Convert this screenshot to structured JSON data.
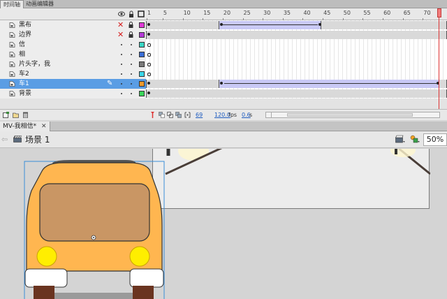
{
  "panel_tabs": [
    {
      "label": "时间轴",
      "active": true
    },
    {
      "label": "动画编辑器",
      "active": false
    }
  ],
  "timeline": {
    "header_icons": [
      "eye-icon",
      "lock-icon",
      "outline-icon"
    ],
    "ruler_labels": [
      "1",
      "5",
      "10",
      "15",
      "20",
      "25",
      "30",
      "35",
      "40",
      "45",
      "50",
      "55",
      "60",
      "65",
      "70"
    ],
    "layers": [
      {
        "name": "黑布",
        "hidden": true,
        "color": "#e03ad6"
      },
      {
        "name": "边界",
        "hidden": true,
        "color": "#b43ad6"
      },
      {
        "name": "信",
        "hidden": false,
        "color": "#3ad6c4"
      },
      {
        "name": "相",
        "hidden": false,
        "color": "#3a6ed6"
      },
      {
        "name": "片头字，我",
        "hidden": false,
        "color": "#7a7a7a"
      },
      {
        "name": "车2",
        "hidden": false,
        "color": "#3ad6e8"
      },
      {
        "name": "车1",
        "hidden": false,
        "color": "#f09a2a",
        "selected": true
      },
      {
        "name": "背景",
        "hidden": false,
        "color": "#3ad65a"
      }
    ],
    "status": {
      "current_frame": "69",
      "fps": "120.0",
      "fps_unit": "fps",
      "time": "0.6",
      "time_unit": "s"
    }
  },
  "document": {
    "tab_label": "MV-我相信*",
    "scene_label": "场景 1",
    "zoom": "50%"
  },
  "colors": {
    "selection": "#5a9de4",
    "tween": "#c9c9f5",
    "playhead": "#dd3333",
    "bus_body": "#ffb650",
    "bus_window": "#c99664",
    "headlight": "#ffee00"
  }
}
